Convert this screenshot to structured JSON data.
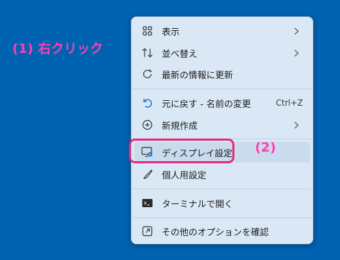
{
  "annotations": {
    "step1": "(1) 右クリック",
    "step2": "(2)"
  },
  "menu": {
    "items": [
      {
        "label": "表示",
        "icon": "grid-icon",
        "submenu": true
      },
      {
        "label": "並べ替え",
        "icon": "sort-icon",
        "submenu": true
      },
      {
        "label": "最新の情報に更新",
        "icon": "refresh-icon",
        "submenu": false
      },
      {
        "label": "元に戻す - 名前の変更",
        "icon": "undo-icon",
        "shortcut": "Ctrl+Z"
      },
      {
        "label": "新規作成",
        "icon": "new-icon",
        "submenu": true
      },
      {
        "label": "ディスプレイ設定",
        "icon": "display-settings-icon",
        "highlighted": true
      },
      {
        "label": "個人用設定",
        "icon": "brush-icon"
      },
      {
        "label": "ターミナルで開く",
        "icon": "terminal-icon"
      },
      {
        "label": "その他のオプションを確認",
        "icon": "more-options-icon"
      }
    ]
  },
  "colors": {
    "background": "#0063b1",
    "menu": "#dae8f5",
    "annotation": "#ff3fb4",
    "ring": "#e6267a"
  }
}
